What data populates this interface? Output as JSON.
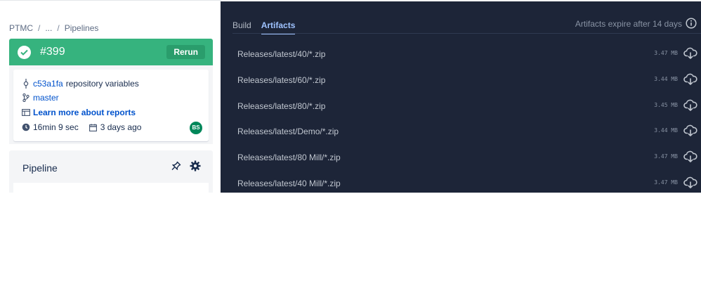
{
  "breadcrumb": {
    "items": [
      "PTMC",
      "...",
      "Pipelines"
    ],
    "separator": "/"
  },
  "build": {
    "number": "#399",
    "rerun_label": "Rerun",
    "status_color": "#36b37e"
  },
  "details": {
    "commit_hash": "c53a1fa",
    "commit_message": "repository variables",
    "branch": "master",
    "reports_link": "Learn more about reports",
    "duration": "16min 9 sec",
    "date": "3 days ago",
    "avatar_initials": "BS"
  },
  "pipeline": {
    "title": "Pipeline"
  },
  "right": {
    "tabs": [
      {
        "label": "Build",
        "active": false
      },
      {
        "label": "Artifacts",
        "active": true
      }
    ],
    "expire_text": "Artifacts expire after 14 days",
    "artifacts": [
      {
        "path": "Releases/latest/40/*.zip",
        "size": "3.47 MB"
      },
      {
        "path": "Releases/latest/60/*.zip",
        "size": "3.44 MB"
      },
      {
        "path": "Releases/latest/80/*.zip",
        "size": "3.45 MB"
      },
      {
        "path": "Releases/latest/Demo/*.zip",
        "size": "3.44 MB"
      },
      {
        "path": "Releases/latest/80 Mill/*.zip",
        "size": "3.47 MB"
      },
      {
        "path": "Releases/latest/40 Mill/*.zip",
        "size": "3.47 MB"
      }
    ]
  },
  "icons": {
    "success": "check-circle-icon",
    "commit": "commit-icon",
    "branch": "branch-icon",
    "reports": "report-icon",
    "duration": "clock-icon",
    "date": "calendar-icon",
    "pin": "pin-icon",
    "settings": "gear-icon",
    "info": "info-icon",
    "download": "cloud-download-icon"
  },
  "colors": {
    "dark_panel": "#1d2538",
    "accent_link": "#0052cc",
    "active_tab": "#9fc3ff"
  }
}
